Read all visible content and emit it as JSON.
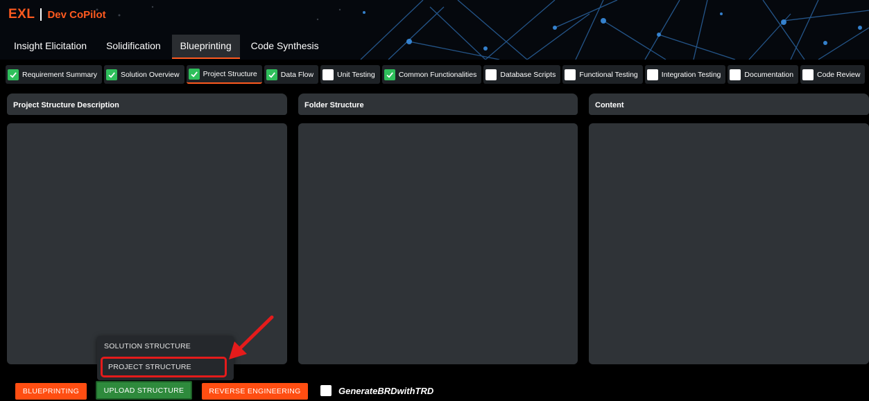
{
  "header": {
    "logo": "EXL",
    "app_name": "Dev CoPilot"
  },
  "main_tabs": [
    {
      "label": "Insight Elicitation",
      "active": false
    },
    {
      "label": "Solidification",
      "active": false
    },
    {
      "label": "Blueprinting",
      "active": true
    },
    {
      "label": "Code Synthesis",
      "active": false
    }
  ],
  "sub_tabs": [
    {
      "label": "Requirement Summary",
      "checked": true
    },
    {
      "label": "Solution Overview",
      "checked": true
    },
    {
      "label": "Project Structure",
      "checked": true,
      "active": true
    },
    {
      "label": "Data Flow",
      "checked": true
    },
    {
      "label": "Unit Testing",
      "checked": false
    },
    {
      "label": "Common Functionalities",
      "checked": true
    },
    {
      "label": "Database Scripts",
      "checked": false
    },
    {
      "label": "Functional Testing",
      "checked": false
    },
    {
      "label": "Integration Testing",
      "checked": false
    },
    {
      "label": "Documentation",
      "checked": false
    },
    {
      "label": "Code Review",
      "checked": false
    }
  ],
  "panels": {
    "description_title": "Project Structure Description",
    "folder_title": "Folder Structure",
    "content_title": "Content"
  },
  "dropdown": {
    "items": [
      "SOLUTION STRUCTURE",
      "PROJECT STRUCTURE"
    ],
    "highlighted": "PROJECT STRUCTURE"
  },
  "buttons": {
    "blueprinting": "BLUEPRINTING",
    "upload_structure": "UPLOAD STRUCTURE",
    "reverse_engineering": "REVERSE ENGINEERING"
  },
  "generate_option": {
    "label": "GenerateBRDwithTRD",
    "checked": false
  },
  "colors": {
    "accent": "#ff5a1f",
    "panel": "#2f3337",
    "check": "#2fbf5b",
    "highlight": "#e51b1b"
  }
}
